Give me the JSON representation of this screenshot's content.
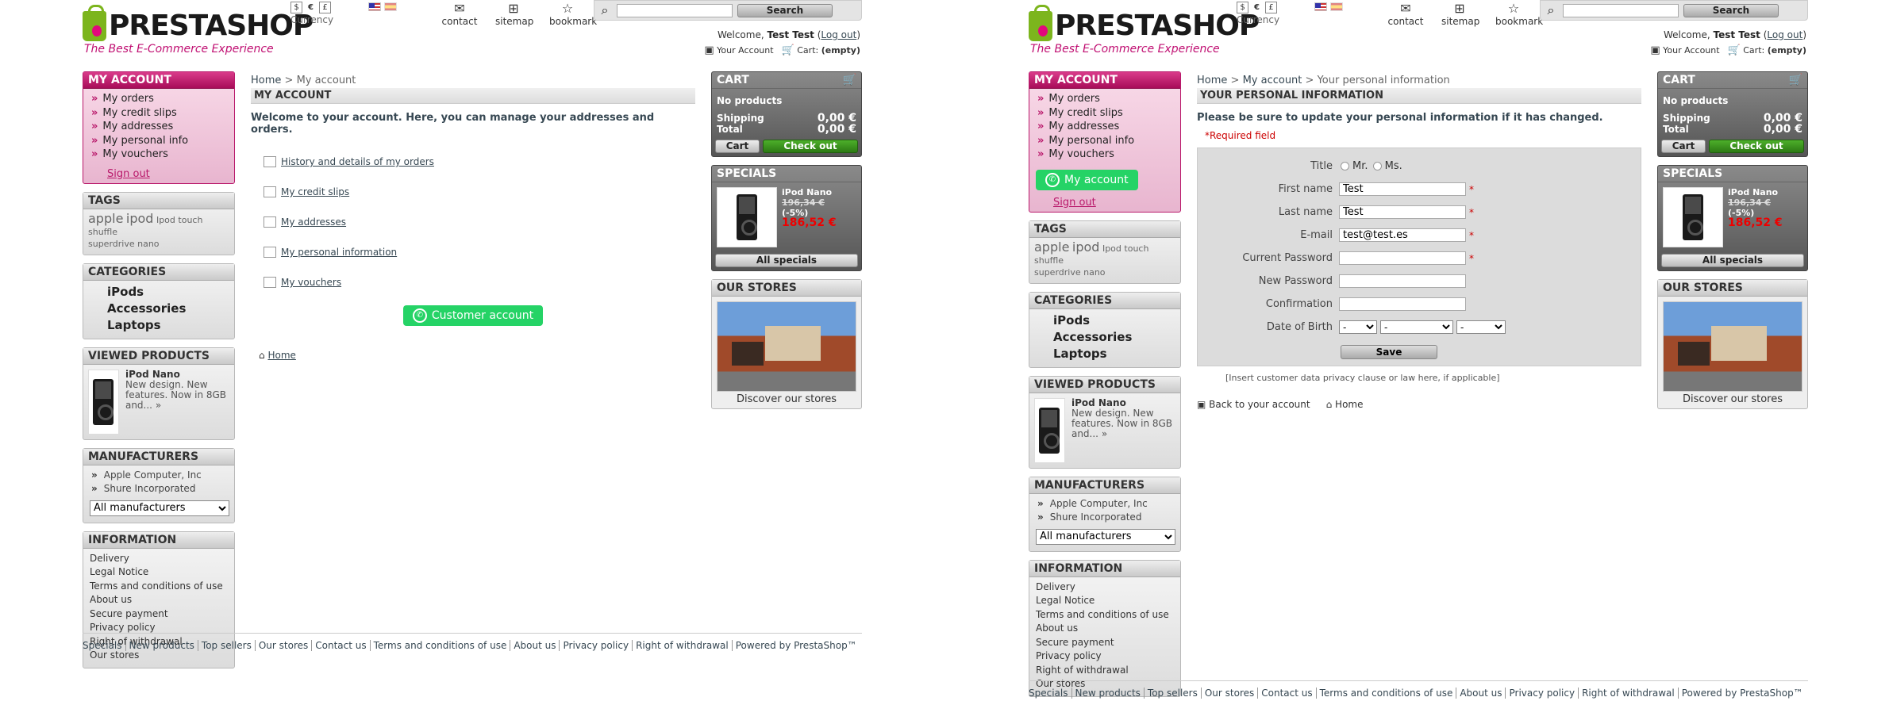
{
  "header": {
    "logo_text": "PRESTASHOP",
    "tagline": "The Best E-Commerce Experience",
    "currencies": [
      "$",
      "€",
      "£"
    ],
    "currency_label": "Currency",
    "permanent_links": [
      {
        "label": "contact",
        "icon": "envelope-icon"
      },
      {
        "label": "sitemap",
        "icon": "sitemap-icon"
      },
      {
        "label": "bookmark",
        "icon": "star-icon"
      }
    ],
    "search_button": "Search",
    "welcome_prefix": "Welcome,",
    "user_name": "Test Test",
    "logout": "Log out",
    "your_account": "Your Account",
    "cart_prefix": "Cart:",
    "cart_state": "(empty)"
  },
  "left": {
    "myaccount_title": "MY ACCOUNT",
    "myaccount_items": [
      "My orders",
      "My credit slips",
      "My addresses",
      "My personal info",
      "My vouchers"
    ],
    "sign_out": "Sign out",
    "whatsapp_label": "My account",
    "tags_title": "TAGS",
    "tags_line1": [
      "apple",
      "ipod",
      "Ipod",
      "touch",
      "shuffle"
    ],
    "tags_line2": [
      "superdrive",
      "nano"
    ],
    "categories_title": "CATEGORIES",
    "categories": [
      "iPods",
      "Accessories",
      "Laptops"
    ],
    "viewed_title": "VIEWED PRODUCTS",
    "viewed_name": "iPod Nano",
    "viewed_desc": "New design. New features. Now in 8GB and...",
    "manufacturers_title": "MANUFACTURERS",
    "manufacturers": [
      "Apple Computer, Inc",
      "Shure Incorporated"
    ],
    "manufacturers_select": "All manufacturers",
    "information_title": "INFORMATION",
    "information": [
      "Delivery",
      "Legal Notice",
      "Terms and conditions of use",
      "About us",
      "Secure payment",
      "Privacy policy",
      "Right of withdrawal",
      "Our stores"
    ]
  },
  "page_a": {
    "breadcrumb_home": "Home",
    "breadcrumb_current": "My account",
    "title": "MY ACCOUNT",
    "lead": "Welcome to your account. Here, you can manage your addresses and orders.",
    "links": [
      "History and details of my orders",
      "My credit slips",
      "My addresses",
      "My personal information",
      "My vouchers"
    ],
    "customer_button": "Customer account",
    "home": "Home"
  },
  "page_b": {
    "breadcrumb_home": "Home",
    "breadcrumb_mid": "My account",
    "breadcrumb_current": "Your personal information",
    "title": "YOUR PERSONAL INFORMATION",
    "lead": "Please be sure to update your personal information if it has changed.",
    "required": "Required field",
    "title_label": "Title",
    "mr": "Mr.",
    "ms": "Ms.",
    "first_name_label": "First name",
    "first_name": "Test",
    "last_name_label": "Last name",
    "last_name": "Test",
    "email_label": "E-mail",
    "email": "test@test.es",
    "current_pw_label": "Current Password",
    "new_pw_label": "New Password",
    "confirm_label": "Confirmation",
    "dob_label": "Date of Birth",
    "dob_placeholder": "-",
    "save": "Save",
    "privacy": "[Insert customer data privacy clause or law here, if applicable]",
    "back": "Back to your account",
    "home": "Home"
  },
  "right": {
    "cart_title": "CART",
    "no_products": "No products",
    "shipping_label": "Shipping",
    "shipping_value": "0,00 €",
    "total_label": "Total",
    "total_value": "0,00 €",
    "cart_button": "Cart",
    "checkout_button": "Check out",
    "specials_title": "SPECIALS",
    "special_name": "iPod Nano",
    "special_old": "196,34 €",
    "special_discount": "(-5%)",
    "special_new": "186,52 €",
    "all_specials": "All specials",
    "stores_title": "OUR STORES",
    "stores_label": "Discover our stores"
  },
  "footer": [
    "Specials",
    "New products",
    "Top sellers",
    "Our stores",
    "Contact us",
    "Terms and conditions of use",
    "About us",
    "Privacy policy",
    "Right of withdrawal",
    "Powered by PrestaShop™"
  ],
  "colors": {
    "brand_pink": "#c00f72",
    "brand_green": "#7cb51d",
    "whatsapp": "#25d366",
    "checkout_green": "#3b9a1f"
  }
}
